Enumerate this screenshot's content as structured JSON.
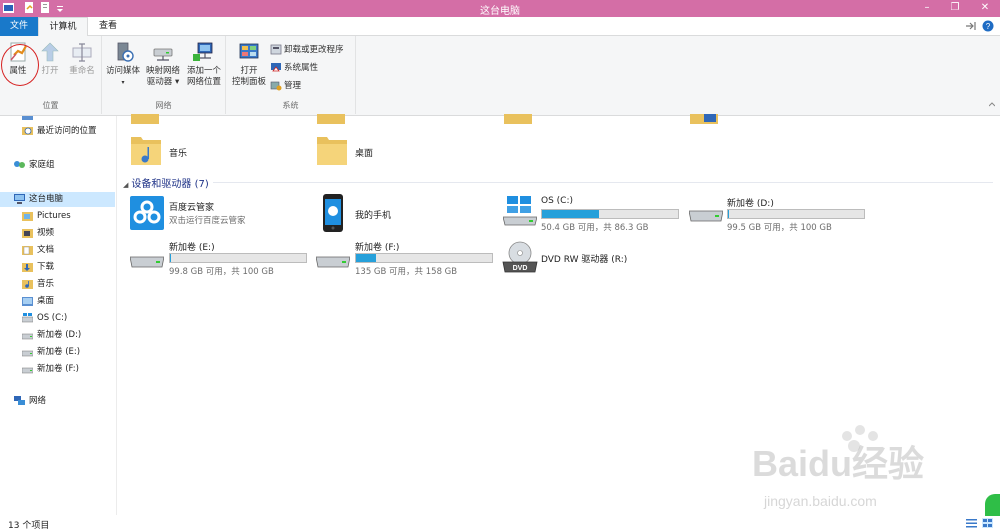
{
  "window": {
    "title": "这台电脑",
    "controls": {
      "minimize": "–",
      "restore": "❐",
      "close": "✕"
    }
  },
  "tabs": [
    {
      "label": "文件"
    },
    {
      "label": "计算机"
    },
    {
      "label": "查看"
    }
  ],
  "ribbon": {
    "location_group": {
      "label": "位置",
      "properties": "属性",
      "open": "打开",
      "rename": "重命名"
    },
    "network_group": {
      "label": "网络",
      "access_media": "访问媒体",
      "map_drive_l1": "映射网络",
      "map_drive_l2": "驱动器",
      "add_location_l1": "添加一个",
      "add_location_l2": "网络位置"
    },
    "system_group": {
      "label": "系统",
      "control_panel_l1": "打开",
      "control_panel_l2": "控制面板",
      "uninstall": "卸载或更改程序",
      "system_properties": "系统属性",
      "manage": "管理"
    }
  },
  "nav": {
    "recent": "最近访问的位置",
    "homegroup": "家庭组",
    "this_pc": "这台电脑",
    "children": [
      "Pictures",
      "视频",
      "文档",
      "下载",
      "音乐",
      "桌面",
      "OS (C:)",
      "新加卷 (D:)",
      "新加卷 (E:)",
      "新加卷 (F:)"
    ],
    "network": "网络"
  },
  "folders": {
    "music": "音乐",
    "desktop": "桌面"
  },
  "devices_section": {
    "title": "设备和驱动器 (7)"
  },
  "devices": {
    "baidu": {
      "name": "百度云管家",
      "sub": "双击运行百度云管家"
    },
    "phone": {
      "name": "我的手机"
    },
    "c": {
      "name": "OS (C:)",
      "usage": "50.4 GB 可用，共 86.3 GB",
      "used_fraction": 0.42
    },
    "d": {
      "name": "新加卷 (D:)",
      "usage": "99.5 GB 可用，共 100 GB",
      "used_fraction": 0.005
    },
    "e": {
      "name": "新加卷 (E:)",
      "usage": "99.8 GB 可用，共 100 GB",
      "used_fraction": 0.002
    },
    "f": {
      "name": "新加卷 (F:)",
      "usage": "135 GB 可用，共 158 GB",
      "used_fraction": 0.15
    },
    "dvd": {
      "name": "DVD RW 驱动器 (R:)",
      "badge": "DVD"
    }
  },
  "status": {
    "count": "13 个项目"
  },
  "watermark": {
    "brand": "Baidu经验",
    "url": "jingyan.baidu.com"
  },
  "colors": {
    "titlebar": "#d46ea6",
    "file_tab": "#1979ca",
    "drive_bar": "#26a0da",
    "section_header": "#1e3287"
  }
}
